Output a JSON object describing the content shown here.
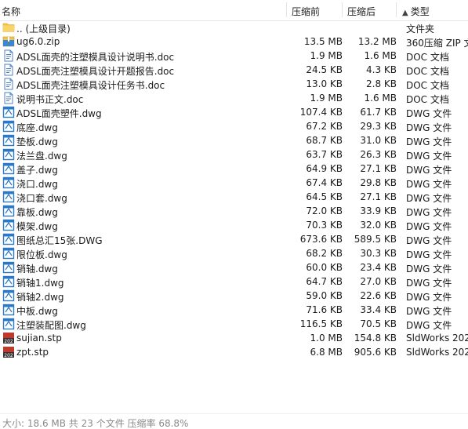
{
  "header": {
    "name": "名称",
    "size": "压缩前",
    "packed": "压缩后",
    "type": "类型",
    "sort_indicator": "▲"
  },
  "rows": [
    {
      "icon": "folder-up-icon",
      "name": ".. (上级目录)",
      "size": "",
      "packed": "",
      "type": "文件夹"
    },
    {
      "icon": "zip-archive-icon",
      "name": "ug6.0.zip",
      "size": "13.5 MB",
      "packed": "13.2 MB",
      "type": "360压缩 ZIP 文件"
    },
    {
      "icon": "doc-file-icon",
      "name": "ADSL面壳的注塑模具设计说明书.doc",
      "size": "1.9 MB",
      "packed": "1.6 MB",
      "type": "DOC 文档"
    },
    {
      "icon": "doc-file-icon",
      "name": "ADSL面壳注塑模具设计开题报告.doc",
      "size": "24.5 KB",
      "packed": "4.3 KB",
      "type": "DOC 文档"
    },
    {
      "icon": "doc-file-icon",
      "name": "ADSL面壳注塑模具设计任务书.doc",
      "size": "13.0 KB",
      "packed": "2.8 KB",
      "type": "DOC 文档"
    },
    {
      "icon": "doc-file-icon",
      "name": "说明书正文.doc",
      "size": "1.9 MB",
      "packed": "1.6 MB",
      "type": "DOC 文档"
    },
    {
      "icon": "dwg-file-icon",
      "name": "ADSL面壳塑件.dwg",
      "size": "107.4 KB",
      "packed": "61.7 KB",
      "type": "DWG 文件"
    },
    {
      "icon": "dwg-file-icon",
      "name": "底座.dwg",
      "size": "67.2 KB",
      "packed": "29.3 KB",
      "type": "DWG 文件"
    },
    {
      "icon": "dwg-file-icon",
      "name": "垫板.dwg",
      "size": "68.7 KB",
      "packed": "31.0 KB",
      "type": "DWG 文件"
    },
    {
      "icon": "dwg-file-icon",
      "name": "法兰盘.dwg",
      "size": "63.7 KB",
      "packed": "26.3 KB",
      "type": "DWG 文件"
    },
    {
      "icon": "dwg-file-icon",
      "name": "盖子.dwg",
      "size": "64.9 KB",
      "packed": "27.1 KB",
      "type": "DWG 文件"
    },
    {
      "icon": "dwg-file-icon",
      "name": "浇口.dwg",
      "size": "67.4 KB",
      "packed": "29.8 KB",
      "type": "DWG 文件"
    },
    {
      "icon": "dwg-file-icon",
      "name": "浇口套.dwg",
      "size": "64.5 KB",
      "packed": "27.1 KB",
      "type": "DWG 文件"
    },
    {
      "icon": "dwg-file-icon",
      "name": "靠板.dwg",
      "size": "72.0 KB",
      "packed": "33.9 KB",
      "type": "DWG 文件"
    },
    {
      "icon": "dwg-file-icon",
      "name": "模架.dwg",
      "size": "70.3 KB",
      "packed": "32.0 KB",
      "type": "DWG 文件"
    },
    {
      "icon": "dwg-file-icon",
      "name": "图纸总汇15张.DWG",
      "size": "673.6 KB",
      "packed": "589.5 KB",
      "type": "DWG 文件"
    },
    {
      "icon": "dwg-file-icon",
      "name": "限位板.dwg",
      "size": "68.2 KB",
      "packed": "30.3 KB",
      "type": "DWG 文件"
    },
    {
      "icon": "dwg-file-icon",
      "name": "销轴.dwg",
      "size": "60.0 KB",
      "packed": "23.4 KB",
      "type": "DWG 文件"
    },
    {
      "icon": "dwg-file-icon",
      "name": "销轴1.dwg",
      "size": "64.7 KB",
      "packed": "27.0 KB",
      "type": "DWG 文件"
    },
    {
      "icon": "dwg-file-icon",
      "name": "销轴2.dwg",
      "size": "59.0 KB",
      "packed": "22.6 KB",
      "type": "DWG 文件"
    },
    {
      "icon": "dwg-file-icon",
      "name": "中板.dwg",
      "size": "71.6 KB",
      "packed": "33.4 KB",
      "type": "DWG 文件"
    },
    {
      "icon": "dwg-file-icon",
      "name": "注塑装配图.dwg",
      "size": "116.5 KB",
      "packed": "70.5 KB",
      "type": "DWG 文件"
    },
    {
      "icon": "stp-file-icon",
      "name": "sujian.stp",
      "size": "1.0 MB",
      "packed": "154.8 KB",
      "type": "SldWorks 2020"
    },
    {
      "icon": "stp-file-icon",
      "name": "zpt.stp",
      "size": "6.8 MB",
      "packed": "905.6 KB",
      "type": "SldWorks 2020"
    }
  ],
  "status": {
    "text": "大小: 18.6 MB 共 23 个文件 压缩率 68.8%"
  },
  "colors": {
    "folder": "#f5c342",
    "dwg": "#2b78c4",
    "doc": "#4d7fc7",
    "stp": "#c0392b"
  }
}
